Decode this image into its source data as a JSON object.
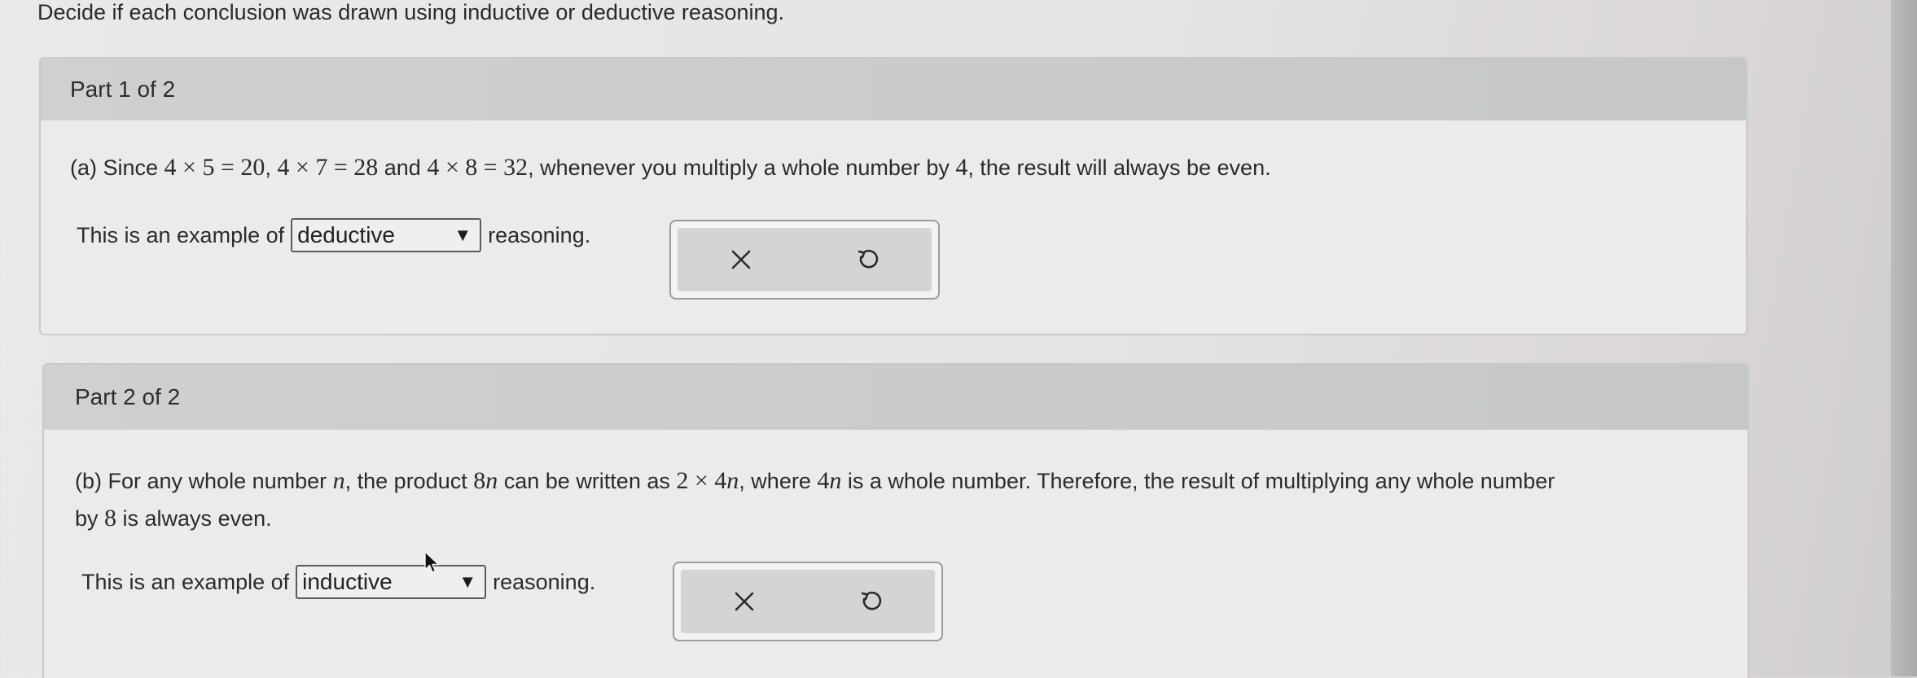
{
  "instructions": "Decide if each conclusion was drawn using inductive or deductive reasoning.",
  "parts": [
    {
      "header": "Part 1 of 2",
      "question": {
        "prefix": "(a) Since ",
        "expr1": "4 × 5 = 20",
        "sep1": ", ",
        "expr2": "4 × 7 = 28",
        "sep2": " and ",
        "expr3": "4 × 8 = 32",
        "middle": ", whenever you multiply a whole number by ",
        "num": "4",
        "suffix": ", the result will always be even."
      },
      "answer_prefix": "This is an example of",
      "selected": "deductive",
      "answer_suffix": "reasoning."
    },
    {
      "header": "Part 2 of 2",
      "question": {
        "prefix": "(b) For any whole number ",
        "var_n": "n",
        "t1": ", the product ",
        "expr_8n": "8",
        "t2": " can be written as ",
        "expr_2x4n": "2 × 4",
        "t3": ", where ",
        "expr_4n": "4",
        "t4": " is a whole number. Therefore, the result of multiplying any whole number",
        "line2_prefix": "by ",
        "num8": "8",
        "line2_suffix": " is always even."
      },
      "answer_prefix": "This is an example of",
      "selected": "inductive",
      "answer_suffix": "reasoning."
    }
  ],
  "dropdown_options": [
    "inductive",
    "deductive"
  ],
  "icons": {
    "dropdown": "triangle-down-icon",
    "clear": "x-icon",
    "undo": "undo-icon"
  },
  "colors": {
    "header_bg": "#c8cac8",
    "panel_bg": "#ebebea",
    "tools_bg": "#d3d5d4"
  }
}
